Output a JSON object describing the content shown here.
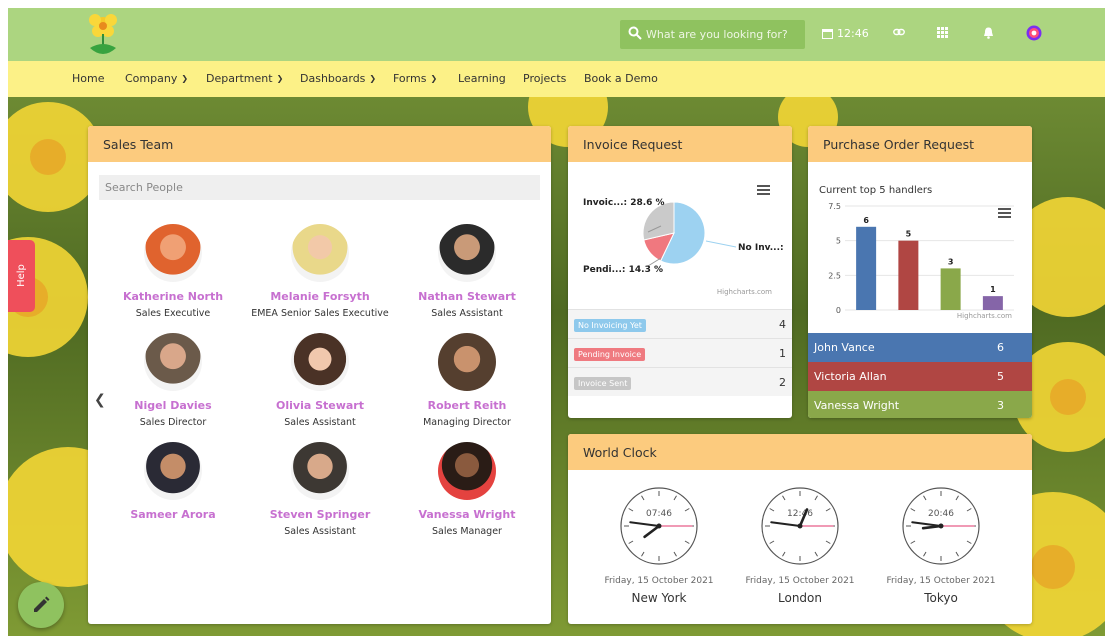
{
  "header": {
    "search_placeholder": "What are you looking for?",
    "time": "12:46",
    "icons": [
      "search-icon",
      "calendar-icon",
      "link-icon",
      "apps-grid-icon",
      "bell-icon",
      "user-avatar-icon"
    ]
  },
  "nav": {
    "items": [
      {
        "label": "Home",
        "dropdown": false
      },
      {
        "label": "Company",
        "dropdown": true
      },
      {
        "label": "Department",
        "dropdown": true
      },
      {
        "label": "Dashboards",
        "dropdown": true
      },
      {
        "label": "Forms",
        "dropdown": true
      },
      {
        "label": "Learning",
        "dropdown": false
      },
      {
        "label": "Projects",
        "dropdown": false
      },
      {
        "label": "Book a Demo",
        "dropdown": false
      }
    ]
  },
  "sales_team": {
    "title": "Sales Team",
    "search_placeholder": "Search People",
    "people": [
      {
        "name": "Katherine North",
        "role": "Sales Executive"
      },
      {
        "name": "Melanie Forsyth",
        "role": "EMEA Senior Sales Executive"
      },
      {
        "name": "Nathan Stewart",
        "role": "Sales Assistant"
      },
      {
        "name": "Nigel Davies",
        "role": "Sales Director"
      },
      {
        "name": "Olivia Stewart",
        "role": "Sales Assistant"
      },
      {
        "name": "Robert Reith",
        "role": "Managing Director"
      },
      {
        "name": "Sameer Arora",
        "role": ""
      },
      {
        "name": "Steven Springer",
        "role": "Sales Assistant"
      },
      {
        "name": "Vanessa Wright",
        "role": "Sales Manager"
      }
    ]
  },
  "invoice": {
    "title": "Invoice Request",
    "chart_labels": {
      "sent": "Invoic...: 28.6 %",
      "pending": "Pendi...: 14.3 %",
      "none": "No Inv...:"
    },
    "credit": "Highcharts.com",
    "rows": [
      {
        "label": "No Invoicing Yet",
        "count": "4",
        "color": "#8ec9ec"
      },
      {
        "label": "Pending Invoice",
        "count": "1",
        "color": "#ef7a80"
      },
      {
        "label": "Invoice Sent",
        "count": "2",
        "color": "#c6c6c6"
      }
    ]
  },
  "purchase": {
    "title": "Purchase Order Request",
    "credit": "Highcharts.com",
    "rows": [
      {
        "name": "John Vance",
        "count": "6",
        "color": "#4a76b0"
      },
      {
        "name": "Victoria Allan",
        "count": "5",
        "color": "#b04643"
      },
      {
        "name": "Vanessa Wright",
        "count": "3",
        "color": "#8aa84a"
      }
    ]
  },
  "chart_data": [
    {
      "type": "pie",
      "slices": [
        {
          "label": "No Inv...",
          "value": 57.1,
          "color": "#9dd2f1"
        },
        {
          "label": "Pendi...",
          "value": 14.3,
          "color": "#f0787f"
        },
        {
          "label": "Invoic...",
          "value": 28.6,
          "color": "#cacaca"
        }
      ]
    },
    {
      "type": "bar",
      "title": "Current top 5 handlers",
      "ylim": [
        0,
        7.5
      ],
      "yticks": [
        "0",
        "2.5",
        "5",
        "7.5"
      ],
      "values": [
        6,
        5,
        3,
        1
      ],
      "colors": [
        "#4a76b0",
        "#b04643",
        "#8aa84a",
        "#8565a8"
      ]
    }
  ],
  "world_clock": {
    "title": "World Clock",
    "clocks": [
      {
        "time": "07:46",
        "hour": 7,
        "minute": 46,
        "second": 15,
        "date": "Friday, 15 October 2021",
        "city": "New York"
      },
      {
        "time": "12:46",
        "hour": 12,
        "minute": 46,
        "second": 15,
        "date": "Friday, 15 October 2021",
        "city": "London"
      },
      {
        "time": "20:46",
        "hour": 20,
        "minute": 46,
        "second": 15,
        "date": "Friday, 15 October 2021",
        "city": "Tokyo"
      }
    ]
  },
  "help": {
    "label": "Help"
  }
}
